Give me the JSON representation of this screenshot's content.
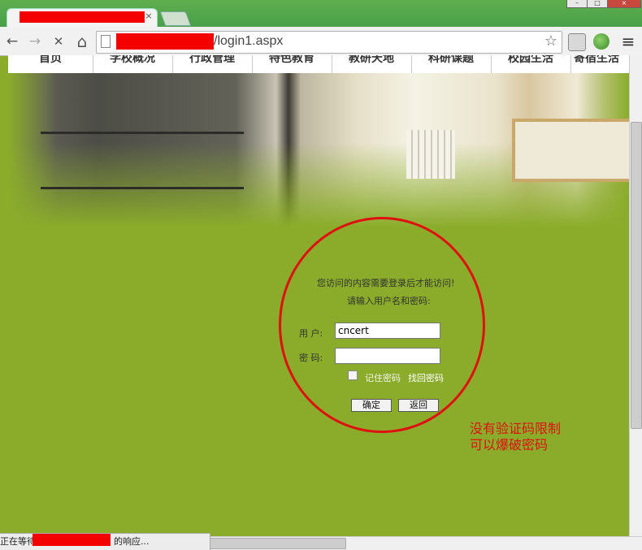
{
  "browser": {
    "tab_close": "×",
    "back_icon": "←",
    "forward_icon": "→",
    "stop_icon": "✕",
    "home_icon": "⌂",
    "url_path": "/login1.aspx",
    "star_icon": "☆",
    "menu_icon": "≡",
    "win_min": "–",
    "win_max": "□",
    "win_close": "×"
  },
  "site_nav": {
    "items": [
      "首页",
      "学校概况",
      "行政管理",
      "特色教育",
      "教研天地",
      "科研课题",
      "校园生活",
      "寄宿生活"
    ]
  },
  "login": {
    "message": "您访问的内容需要登录后才能访问!",
    "prompt": "请输入用户名和密码:",
    "username_label": "用 户:",
    "username_value": "cncert",
    "password_label": "密 码:",
    "password_value": "",
    "remember_label": "记住密码",
    "forgot_link": "找回密码",
    "confirm_button": "确定",
    "back_button": "返回"
  },
  "annotation": {
    "line1": "没有验证码限制",
    "line2": "可以爆破密码",
    "color": "#e01010"
  },
  "status": {
    "prefix": "正在等待",
    "suffix": "的响应..."
  },
  "colors": {
    "page_bg": "#8aac2a",
    "redaction": "#f40000"
  }
}
